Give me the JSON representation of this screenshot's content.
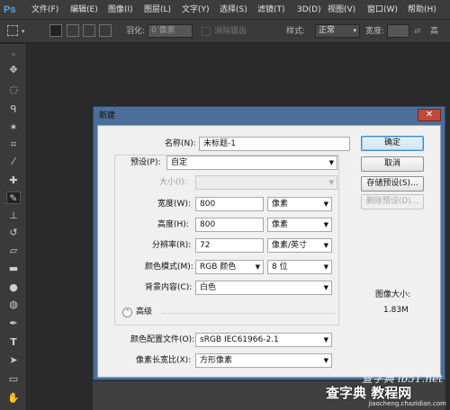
{
  "app": {
    "logo": "Ps"
  },
  "menu": [
    "文件(F)",
    "编辑(E)",
    "图像(I)",
    "图层(L)",
    "文字(Y)",
    "选择(S)",
    "滤镜(T)",
    "3D(D)",
    "视图(V)",
    "窗口(W)",
    "帮助(H)"
  ],
  "window_controls": {
    "minimize": "—",
    "restore": "❐",
    "close": "✕"
  },
  "options": {
    "feather_label": "羽化:",
    "feather_value": "0 像素",
    "antialias_label": "消除锯齿",
    "style_label": "样式:",
    "style_value": "正常",
    "width_label": "宽度:"
  },
  "tools": [
    "move-tool",
    "marquee-tool",
    "lasso-tool",
    "magic-wand-tool",
    "crop-tool",
    "eyedropper-tool",
    "healing-brush-tool",
    "brush-tool",
    "clone-stamp-tool",
    "history-brush-tool",
    "eraser-tool",
    "gradient-tool",
    "blur-tool",
    "dodge-tool",
    "pen-tool",
    "type-tool",
    "path-selection-tool",
    "shape-tool",
    "hand-tool"
  ],
  "dialog": {
    "title": "新建",
    "close": "✕",
    "name_label": "名称(N):",
    "name_value": "未标题-1",
    "preset_label": "预设(P):",
    "preset_value": "自定",
    "size_label": "大小(I):",
    "size_value": "",
    "width_label": "宽度(W):",
    "width_value": "800",
    "width_unit": "像素",
    "height_label": "高度(H):",
    "height_value": "800",
    "height_unit": "像素",
    "resolution_label": "分辨率(R):",
    "resolution_value": "72",
    "resolution_unit": "像素/英寸",
    "color_mode_label": "颜色模式(M):",
    "color_mode_value": "RGB 颜色",
    "bit_depth_value": "8 位",
    "background_label": "背景内容(C):",
    "background_value": "白色",
    "advanced_label": "高级",
    "advanced_toggle": "⌃",
    "color_profile_label": "颜色配置文件(O):",
    "color_profile_value": "sRGB IEC61966-2.1",
    "pixel_aspect_label": "像素长宽比(X):",
    "pixel_aspect_value": "方形像素",
    "ok_button": "确定",
    "cancel_button": "取消",
    "save_preset_button": "存储预设(S)...",
    "delete_preset_button": "删除预设(D)...",
    "image_size_label": "图像大小:",
    "image_size_value": "1.83M"
  },
  "watermark": {
    "line1": "查字典  ib51.net",
    "line2": "查字典 教程网",
    "line3": "jiaocheng.chazidian.com"
  }
}
